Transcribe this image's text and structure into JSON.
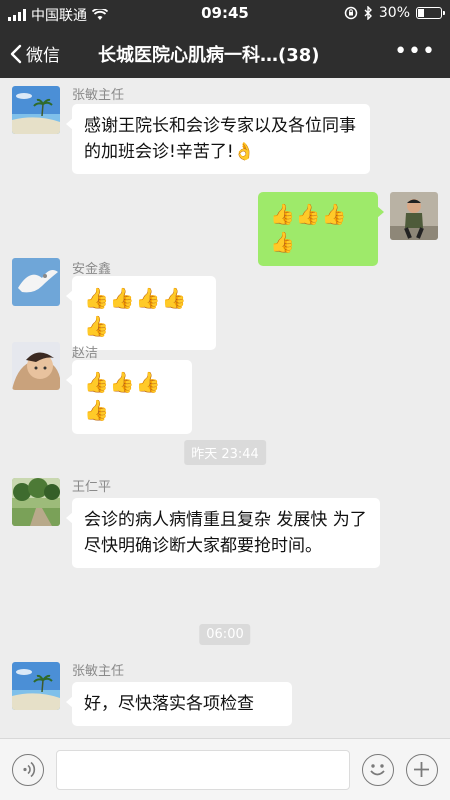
{
  "status_bar": {
    "carrier": "中国联通",
    "time": "09:45",
    "battery": "30%",
    "battery_level": 0.3
  },
  "navbar": {
    "back_label": "微信",
    "title": "长城医院心肌病一科…(38)"
  },
  "messages": [
    {
      "sender": "张敏主任",
      "text": "感谢王院长和会诊专家以及各位同事的加班会诊!辛苦了!👌"
    },
    {
      "text": "👍👍👍👍"
    },
    {
      "sender": "安金鑫",
      "text": "👍👍👍👍👍"
    },
    {
      "sender": "赵洁",
      "text": "👍👍👍👍"
    },
    {
      "sender": "王仁平",
      "text": "会诊的病人病情重且复杂 发展快 为了尽快明确诊断大家都要抢时间。"
    },
    {
      "sender": "张敏主任",
      "text": "好，尽快落实各项检查"
    }
  ],
  "time_dividers": [
    "昨天 23:44",
    "06:00"
  ],
  "input": {
    "placeholder": ""
  }
}
